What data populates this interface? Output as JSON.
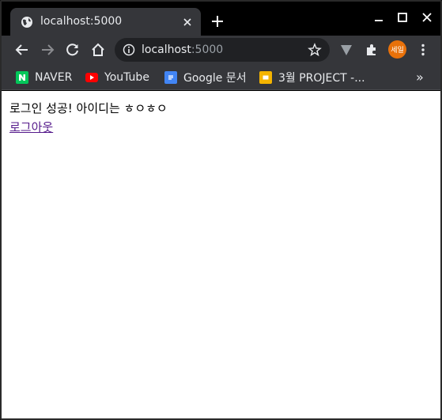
{
  "tab": {
    "title": "localhost:5000",
    "favicon": "globe-icon"
  },
  "toolbar": {
    "url_host": "localhost",
    "url_port": ":5000",
    "avatar_label": "세일"
  },
  "bookmarks": [
    {
      "label": "NAVER",
      "icon": "naver-icon",
      "color": "#03c75a"
    },
    {
      "label": "YouTube",
      "icon": "youtube-icon",
      "color": "#ff0000"
    },
    {
      "label": "Google 문서",
      "icon": "google-docs-icon",
      "color": "#4285f4"
    },
    {
      "label": "3월 PROJECT -...",
      "icon": "google-slides-icon",
      "color": "#f4b400"
    }
  ],
  "bookmarks_more": "»",
  "page": {
    "message": "로그인 성공! 아이디는 ㅎㅇㅎㅇ",
    "logout_link": "로그아웃"
  },
  "colors": {
    "chrome_dark": "#35363a",
    "link_visited": "#551a8b"
  }
}
